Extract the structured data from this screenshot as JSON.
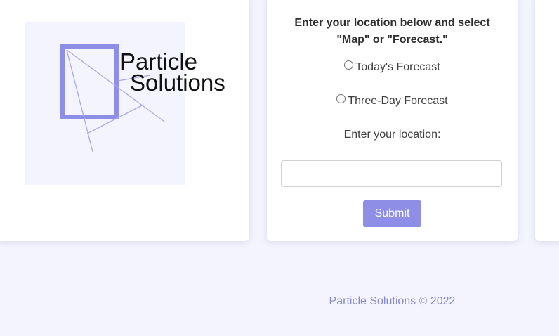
{
  "logo": {
    "line1": "Particle",
    "line2": "Solutions",
    "accent_color": "#8e8ee6"
  },
  "form": {
    "prompt": "Enter your location below and select \"Map\" or \"Forecast.\"",
    "options": [
      {
        "label": "Today's Forecast",
        "selected": false
      },
      {
        "label": "Three-Day Forecast",
        "selected": false
      }
    ],
    "location_label": "Enter your location:",
    "location_value": "",
    "submit_label": "Submit",
    "submit_color": "#8e8ee6"
  },
  "footer": {
    "text": "Particle Solutions © 2022"
  }
}
